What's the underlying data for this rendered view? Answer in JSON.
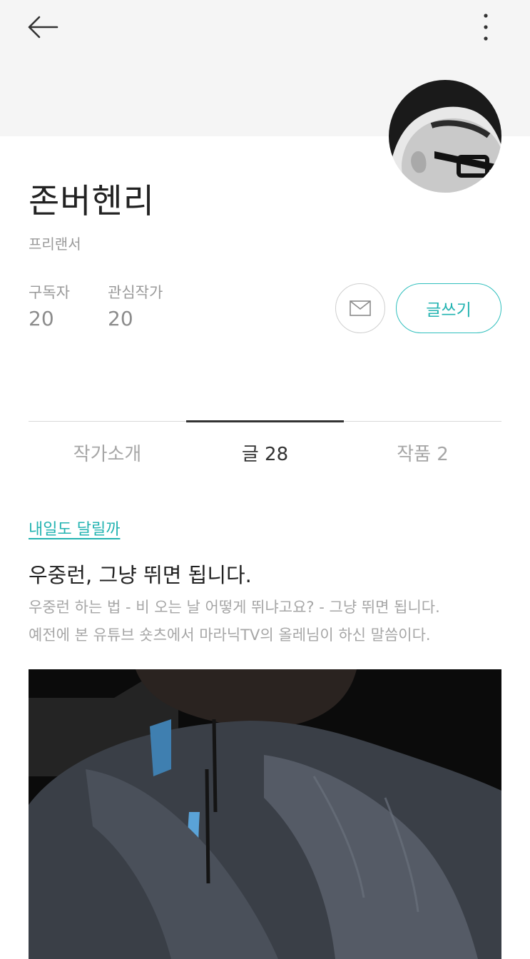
{
  "header": {
    "back_icon": "arrow-left-icon",
    "more_icon": "more-vertical-icon"
  },
  "profile": {
    "name": "존버헨리",
    "role": "프리랜서",
    "stats": {
      "subscribers_label": "구독자",
      "subscribers_value": "20",
      "following_label": "관심작가",
      "following_value": "20"
    },
    "mail_icon": "envelope-icon",
    "write_label": "글쓰기",
    "accent_color": "#22b3b1"
  },
  "tabs": [
    {
      "label": "작가소개",
      "active": false
    },
    {
      "label": "글 28",
      "active": true
    },
    {
      "label": "작품 2",
      "active": false
    }
  ],
  "post": {
    "magazine": "내일도 달릴까",
    "title": "우중런, 그냥 뛰면 됩니다.",
    "excerpt_line1": "우중런 하는 법  - 비 오는 날 어떻게 뛰냐고요? - 그냥 뛰면 됩니다.",
    "excerpt_line2": "예전에 본 유튜브 숏츠에서 마라닉TV의 올레님이 하신 말씀이다."
  }
}
